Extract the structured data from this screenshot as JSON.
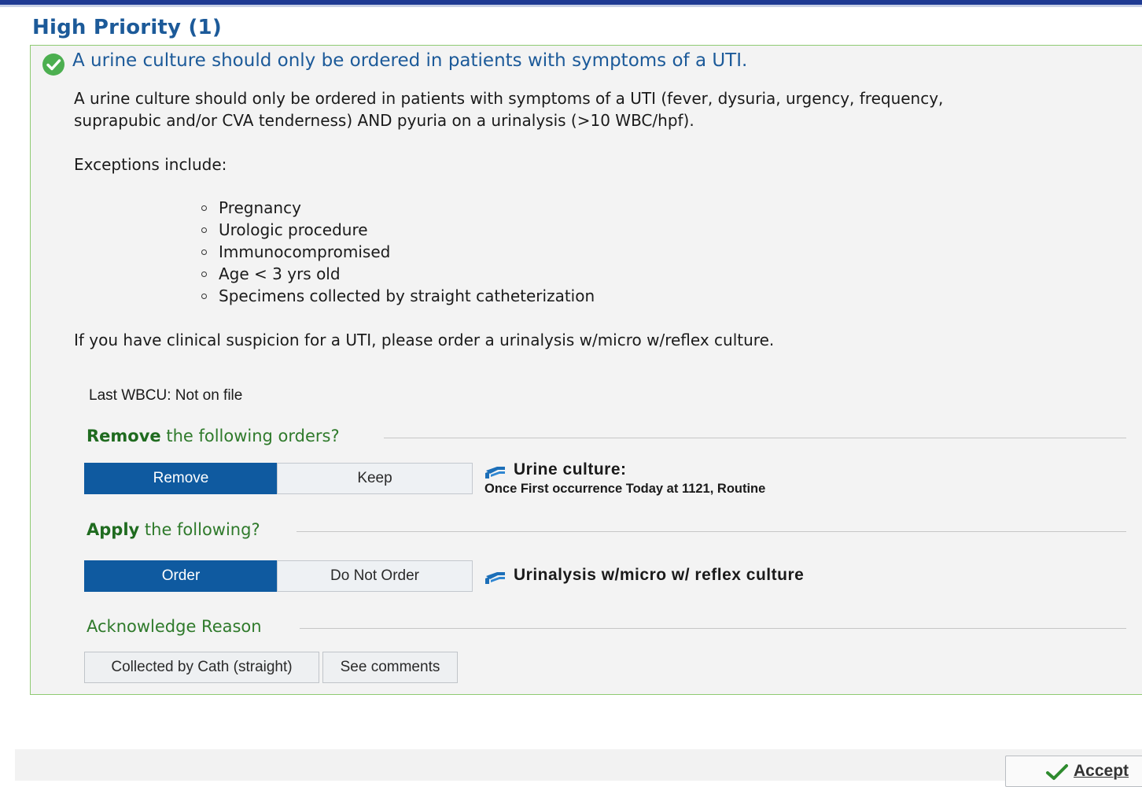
{
  "section": {
    "title": "High Priority (1)"
  },
  "alert": {
    "heading": "A urine culture should only be ordered in patients with symptoms of a UTI.",
    "body_line1": "A urine culture should only be ordered in patients with symptoms of a UTI (fever, dysuria, urgency, frequency,",
    "body_line2": "suprapubic and/or CVA tenderness) AND pyuria on a urinalysis (>10 WBC/hpf).",
    "exceptions_label": "Exceptions include:",
    "exceptions": [
      "Pregnancy",
      "Urologic procedure",
      "Immunocompromised",
      "Age < 3 yrs old",
      "Specimens collected by straight catheterization"
    ],
    "suspicion_text": "If you have clinical suspicion for a UTI, please order a urinalysis w/micro w/reflex culture.",
    "last_wbcu": "Last WBCU: Not on file"
  },
  "remove_section": {
    "heading_bold": "Remove",
    "heading_rest": " the following orders?",
    "remove_label": "Remove",
    "keep_label": "Keep",
    "selected": "Remove",
    "order_title": "Urine culture:",
    "order_detail": "Once First occurrence Today at 1121, Routine"
  },
  "apply_section": {
    "heading_bold": "Apply",
    "heading_rest": " the following?",
    "order_label": "Order",
    "do_not_order_label": "Do Not Order",
    "selected": "Order",
    "order_title": "Urinalysis w/micro w/ reflex culture"
  },
  "acknowledge": {
    "heading": "Acknowledge Reason",
    "reasons": [
      "Collected by Cath (straight)",
      "See comments"
    ]
  },
  "footer": {
    "accept_label": "Accept"
  },
  "colors": {
    "accent_blue": "#1c5a99",
    "button_selected": "#0f5aa0",
    "success_green": "#4caf50",
    "subhead_green": "#2f7a2b"
  }
}
